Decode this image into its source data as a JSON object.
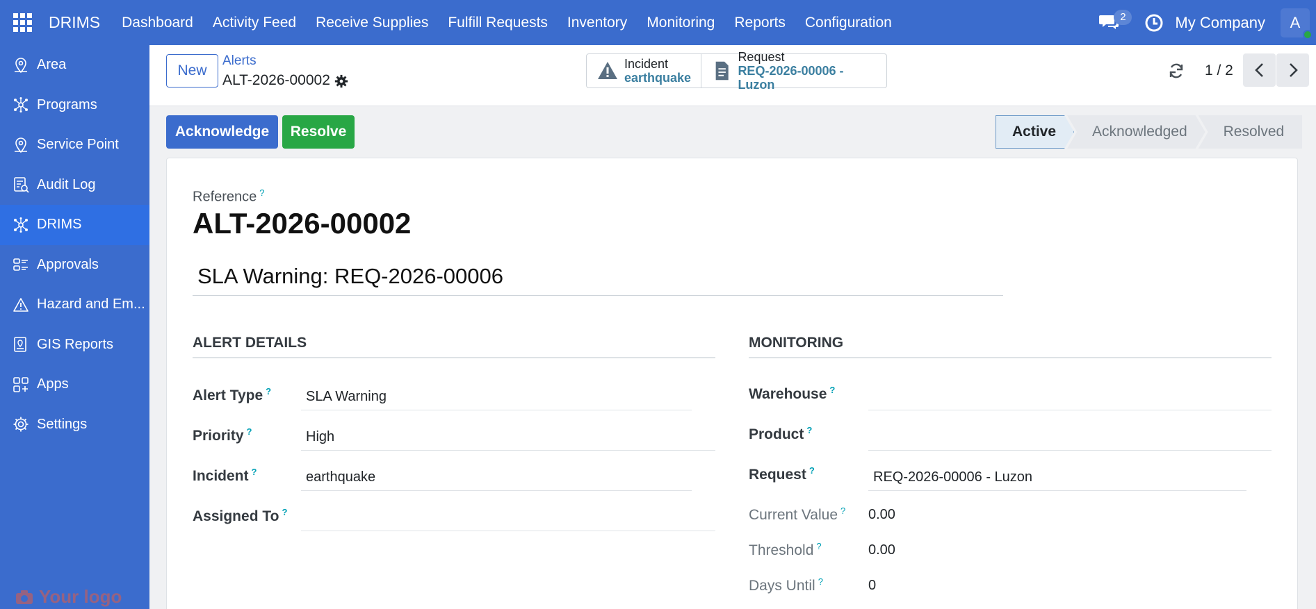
{
  "topbar": {
    "brand": "DRIMS",
    "nav": [
      "Dashboard",
      "Activity Feed",
      "Receive Supplies",
      "Fulfill Requests",
      "Inventory",
      "Monitoring",
      "Reports",
      "Configuration"
    ],
    "chat_count": "2",
    "company": "My Company",
    "avatar_initial": "A"
  },
  "sidebar": {
    "items": [
      {
        "label": "Area",
        "icon": "pin-icon"
      },
      {
        "label": "Programs",
        "icon": "network-icon"
      },
      {
        "label": "Service Point",
        "icon": "pin-icon"
      },
      {
        "label": "Audit Log",
        "icon": "audit-icon"
      },
      {
        "label": "DRIMS",
        "icon": "network-icon"
      },
      {
        "label": "Approvals",
        "icon": "approvals-icon"
      },
      {
        "label": "Hazard and Em...",
        "icon": "warning-icon"
      },
      {
        "label": "GIS Reports",
        "icon": "map-icon"
      },
      {
        "label": "Apps",
        "icon": "apps-icon"
      },
      {
        "label": "Settings",
        "icon": "gear-icon"
      }
    ],
    "active_index": 4,
    "logo_text": "Your logo"
  },
  "control": {
    "new_label": "New",
    "breadcrumb": "Alerts",
    "record": "ALT-2026-00002",
    "smart_buttons": [
      {
        "label": "Incident",
        "value": "earthquake"
      },
      {
        "label": "Request",
        "value": "REQ-2026-00006 - Luzon"
      }
    ],
    "pager": "1 / 2"
  },
  "actions": {
    "acknowledge": "Acknowledge",
    "resolve": "Resolve"
  },
  "status": {
    "stages": [
      "Active",
      "Acknowledged",
      "Resolved"
    ],
    "current": "Active"
  },
  "form": {
    "reference_label": "Reference",
    "reference": "ALT-2026-00002",
    "name": "SLA Warning: REQ-2026-00006",
    "help_mark": "?",
    "alert_details": {
      "title": "ALERT DETAILS",
      "alert_type_label": "Alert Type",
      "alert_type": "SLA Warning",
      "priority_label": "Priority",
      "priority": "High",
      "incident_label": "Incident",
      "incident": "earthquake",
      "assigned_label": "Assigned To",
      "assigned": ""
    },
    "monitoring": {
      "title": "MONITORING",
      "warehouse_label": "Warehouse",
      "warehouse": "",
      "product_label": "Product",
      "product": "",
      "request_label": "Request",
      "request": "REQ-2026-00006 - Luzon",
      "current_value_label": "Current Value",
      "current_value": "0.00",
      "threshold_label": "Threshold",
      "threshold": "0.00",
      "days_until_label": "Days Until",
      "days_until": "0"
    }
  },
  "colors": {
    "primary": "#3b6ccd",
    "success": "#28a745",
    "link": "#3b7fa0",
    "help": "#00a0b5"
  }
}
